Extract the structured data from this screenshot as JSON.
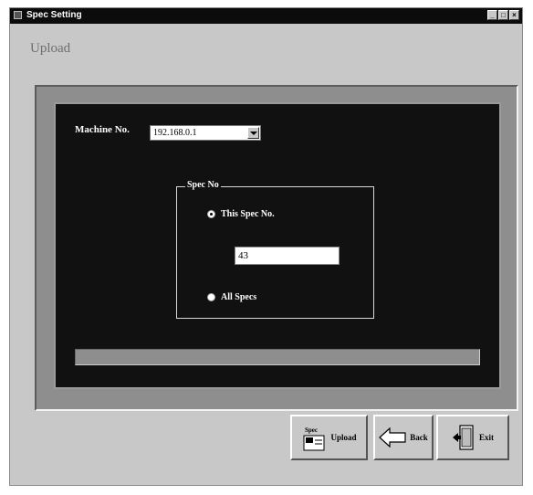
{
  "window": {
    "title": "Spec Setting",
    "controls": [
      "_",
      "□",
      "×"
    ]
  },
  "page": {
    "heading": "Upload"
  },
  "machine": {
    "label": "Machine No.",
    "selected": "192.168.0.1"
  },
  "spec_group": {
    "title": "Spec No",
    "this_spec_label": "This Spec No.",
    "this_spec_value": "43",
    "this_spec_checked": true,
    "all_specs_label": "All Specs",
    "all_specs_checked": false
  },
  "progress": {
    "value_percent": 0
  },
  "buttons": {
    "upload": {
      "label": "Upload",
      "icon": "upload-icon"
    },
    "back": {
      "label": "Back",
      "icon": "back-arrow-icon"
    },
    "exit": {
      "label": "Exit",
      "icon": "exit-door-icon"
    }
  },
  "colors": {
    "panel_bg": "#111111",
    "window_bg": "#c8c8c8",
    "titlebar_bg": "#0c0c0c"
  }
}
